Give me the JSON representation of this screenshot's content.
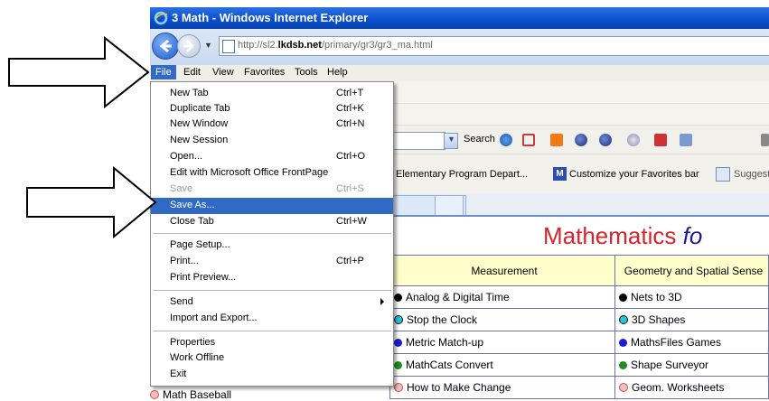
{
  "window": {
    "title": "3 Math - Windows Internet Explorer",
    "title_color": "#0a4fc9"
  },
  "address_bar": {
    "url_prefix": "http://sl2.",
    "url_domain": "lkdsb.net",
    "url_suffix": "/primary/gr3/gr3_ma.html"
  },
  "menubar": {
    "items": [
      "File",
      "Edit",
      "View",
      "Favorites",
      "Tools",
      "Help"
    ],
    "active": "File",
    "highlight_color": "#316ac5"
  },
  "toolbar": {
    "search_label": "Search"
  },
  "favorites_bar": {
    "items": [
      "Elementary Program Depart...",
      "Customize your Favorites bar",
      "Suggested"
    ]
  },
  "file_menu": {
    "items": [
      {
        "label": "New Tab",
        "shortcut": "Ctrl+T"
      },
      {
        "label": "Duplicate Tab",
        "shortcut": "Ctrl+K"
      },
      {
        "label": "New Window",
        "shortcut": "Ctrl+N"
      },
      {
        "label": "New Session",
        "shortcut": ""
      },
      {
        "label": "Open...",
        "shortcut": "Ctrl+O"
      },
      {
        "label": "Edit with Microsoft Office FrontPage",
        "shortcut": ""
      },
      {
        "label": "Save",
        "shortcut": "Ctrl+S",
        "disabled": true
      },
      {
        "label": "Save As...",
        "shortcut": "",
        "selected": true
      },
      {
        "label": "Close Tab",
        "shortcut": "Ctrl+W"
      },
      {
        "label": "Page Setup...",
        "shortcut": ""
      },
      {
        "label": "Print...",
        "shortcut": "Ctrl+P"
      },
      {
        "label": "Print Preview...",
        "shortcut": ""
      },
      {
        "label": "Send",
        "shortcut": "",
        "submenu": true
      },
      {
        "label": "Import and Export...",
        "shortcut": ""
      },
      {
        "label": "Properties",
        "shortcut": ""
      },
      {
        "label": "Work Offline",
        "shortcut": ""
      },
      {
        "label": "Exit",
        "shortcut": ""
      }
    ]
  },
  "page": {
    "heading_main": "Mathematics",
    "heading_italic": "fo",
    "columns": [
      "Measurement",
      "Geometry and Spatial Sense"
    ],
    "rows": [
      {
        "measurement": "Analog & Digital Time",
        "m_color": "#000000",
        "geometry": "Nets to 3D",
        "g_color": "#000000"
      },
      {
        "measurement": "Stop the Clock",
        "m_color": "#22c7d6",
        "geometry": "3D Shapes",
        "g_color": "#22c7d6"
      },
      {
        "measurement": "Metric Match-up",
        "m_color": "#1c1cd6",
        "geometry": "MathsFiles Games",
        "g_color": "#1c1cd6"
      },
      {
        "measurement": "MathCats Convert",
        "m_color": "#1f8f1f",
        "geometry": "Shape Surveyor",
        "g_color": "#1f8f1f"
      },
      {
        "measurement": "How to Make Change",
        "m_color": "#d64a4a",
        "geometry": "Geom. Worksheets",
        "g_color": "#d64a4a"
      }
    ],
    "left_partial": "Math Baseball"
  }
}
